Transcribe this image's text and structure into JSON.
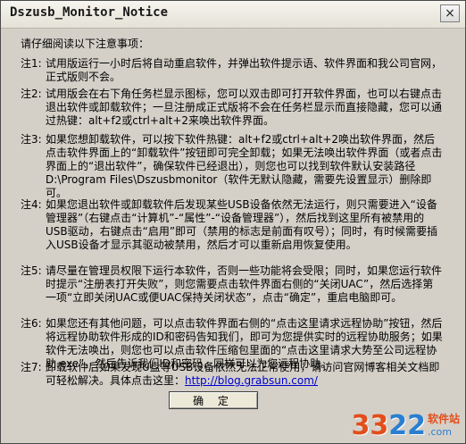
{
  "window": {
    "title": "Dszusb_Monitor_Notice",
    "close_glyph": "×"
  },
  "intro": "请仔细阅读以下注意事项：",
  "notes": [
    {
      "label": "注1:",
      "text": "试用版运行一小时后将自动重启软件，并弹出软件提示语、软件界面和我公司官网，正式版则不会。"
    },
    {
      "label": "注2:",
      "text": "试用版会在右下角任务栏显示图标，您可以双击即可打开软件界面，也可以右键点击退出软件或卸载软件；一旦注册成正式版将不会在任务栏显示而直接隐藏，您可以通过热键：alt+f2或ctrl+alt+2来唤出软件界面。"
    },
    {
      "label": "注3:",
      "text": "如果您想卸载软件，可以按下软件热键：alt+f2或ctrl+alt+2唤出软件界面，然后点击软件界面上的“卸载软件”按钮即可完全卸载；如果无法唤出软件界面（或者点击界面上的“退出软件”，确保软件已经退出），则您也可以找到软件默认安装路径D:\\Program Files\\Dszusbmonitor（软件无默认隐藏，需要先设置显示）删除即可。"
    },
    {
      "label": "注4:",
      "text": "如果您退出软件或卸载软件后发现某些USB设备依然无法运行，则只需要进入“设备管理器”（右键点击“计算机”-“属性”-“设备管理器”），然后找到这里所有被禁用的USB驱动，右键点击“启用”即可（禁用的标志是前面有叹号）；同时，有时候需要插入USB设备才显示其驱动被禁用，然后才可以重新启用恢复使用。"
    },
    {
      "label": "注5:",
      "text": "请尽量在管理员权限下运行本软件，否则一些功能将会受限；同时，如果您运行软件时提示“注册表打开失败”，则您需要点击软件界面右侧的“关闭UAC”，然后选择第一项“立即关闭UAC或便UAC保持关闭状态”，点击“确定”，重启电脑即可。"
    },
    {
      "label": "注6:",
      "text": "如果您还有其他问题，可以点击软件界面右侧的“点击这里请求远程协助”按钮，然后将远程协助软件形成的ID和密码告知我们，即可为您提供实时的远程协助服务；如果软件无法唤出，则您也可以点击软件压缩包里面的“点击这里请求大势至公司远程协助.exe”，然后告诉我们ID和密码，同样可以为您远程协助。"
    },
    {
      "label": "注7:",
      "text_prefix": "卸载软件后如果发现U盘等USB设备依然无法正常使用，请访问官网博客相关文档即可轻松解决。具体点击这里：",
      "link": "http://blog.grabsun.com/"
    }
  ],
  "buttons": {
    "ok": "确 定"
  },
  "watermark": {
    "logo_a": "33",
    "logo_b": "22",
    "site_cn": "软件站",
    "site_en": ".com"
  }
}
